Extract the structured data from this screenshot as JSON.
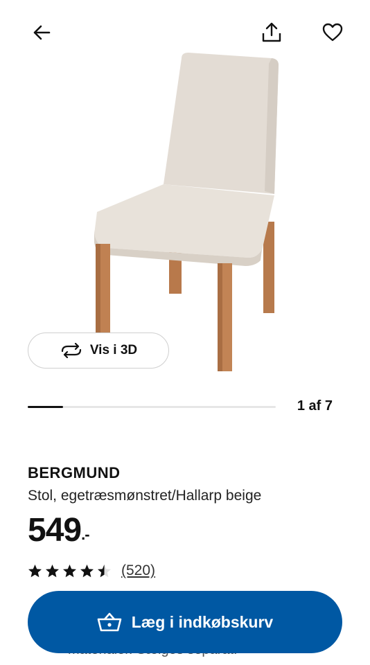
{
  "header": {
    "back_icon": "arrow-left-icon",
    "share_icon": "share-icon",
    "favorite_icon": "heart-icon"
  },
  "gallery": {
    "view_3d_label": "Vis i 3D",
    "view_3d_icon": "rotate-3d-icon",
    "current": 1,
    "total": 7,
    "counter_text": "1 af 7",
    "progress_fraction": 0.143
  },
  "product": {
    "name": "BERGMUND",
    "description": "Stol, egetræsmønstret/Hallarp beige",
    "price": "549",
    "price_suffix": ".-",
    "rating": 4.5,
    "review_count": "(520)"
  },
  "partial_text": "materialer. Sælges separat.",
  "cta": {
    "label": "Læg i indkøbskurv",
    "icon": "basket-icon",
    "color": "#0058a3"
  }
}
